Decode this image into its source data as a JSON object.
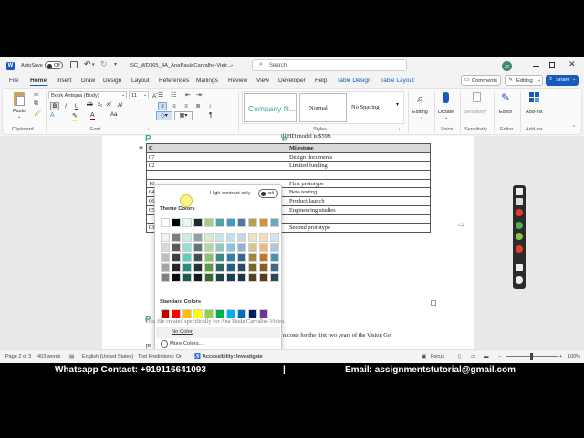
{
  "titlebar": {
    "autosave_label": "AutoSave",
    "autosave_state": "Off",
    "doc_title": "SC_WD365_4A_AnaPaulaCarvalho-Vieir...",
    "search_placeholder": "Search",
    "user_initials": "JG"
  },
  "menu": {
    "items": [
      "File",
      "Home",
      "Insert",
      "Draw",
      "Design",
      "Layout",
      "References",
      "Mailings",
      "Review",
      "View",
      "Developer",
      "Help",
      "Table Design",
      "Table Layout"
    ],
    "comments_label": "Comments",
    "editing_label": "Editing",
    "share_label": "Share"
  },
  "ribbon": {
    "paste_label": "Paste",
    "clipboard_label": "Clipboard",
    "font_name": "Book Antiqua (Body)",
    "font_size": "11",
    "font_label": "Font",
    "styles": [
      "Company N...",
      "Normal",
      "No Spacing"
    ],
    "styles_label": "Styles",
    "editing_label": "Editing",
    "dictate_label": "Dictate",
    "sensitivity_label": "Sensitivity",
    "editor_label": "Editor",
    "addins_label": "Add-ins",
    "voice_label": "Voice",
    "bold": "B",
    "italic": "I",
    "underline": "U",
    "pilcrow": "¶"
  },
  "document": {
    "line1": "ill HD model is $599.",
    "heading_partial": "P",
    "heading_partial2": "P",
    "heading_suffix": "e",
    "para_fragment": "n costs for the first two years of the Vision Go",
    "para_fragment2": "pr",
    "table_header": [
      "C",
      "Milestone"
    ],
    "table_rows": [
      [
        "07",
        "Design documents"
      ],
      [
        "02",
        "Limited funding"
      ],
      [
        "",
        ""
      ],
      [
        "10",
        "First prototype"
      ],
      [
        "04",
        "Beta testing"
      ],
      [
        "06",
        "Product launch"
      ],
      [
        "05",
        "Engineering studies"
      ],
      [
        "",
        ""
      ],
      [
        "03",
        "Second prototype"
      ]
    ],
    "footer_note": "This file created specifically for Ana Paula Carvalho-Vieira"
  },
  "palette": {
    "high_contrast_label": "High-contrast only",
    "high_contrast_state": "Off",
    "theme_label": "Theme Colors",
    "standard_label": "Standard Colors",
    "no_color_label": "No Color",
    "more_colors_label": "More Colors...",
    "theme_top": [
      "#ffffff",
      "#000000",
      "#e6f7f4",
      "#1f2b2b",
      "#9ccf8a",
      "#4ea6a0",
      "#3d9bc5",
      "#4b78a8",
      "#b9a04e",
      "#d88f38",
      "#6fa5c4"
    ],
    "theme_shades": [
      [
        "#f2f2f2",
        "#7f7f7f",
        "#c9efe8",
        "#8fa3a3",
        "#d6ebcd",
        "#c9e4e2",
        "#c3e0ef",
        "#c8d6e7",
        "#ebe2c6",
        "#f6dcbc",
        "#d3e4ee"
      ],
      [
        "#d9d9d9",
        "#595959",
        "#93dfd2",
        "#5f7777",
        "#b1d8a1",
        "#93c9c5",
        "#8ac2e0",
        "#94afd0",
        "#d7c58e",
        "#edb97b",
        "#a8cadd"
      ],
      [
        "#bfbfbf",
        "#3f3f3f",
        "#5dcfbd",
        "#3e5050",
        "#84c46e",
        "#3c8a85",
        "#2f80a6",
        "#3a6290",
        "#a0883c",
        "#c2772a",
        "#4e8fb5"
      ],
      [
        "#a6a6a6",
        "#262626",
        "#2a8c7c",
        "#273232",
        "#5c9a46",
        "#2d6864",
        "#236080",
        "#2c4a6c",
        "#78662d",
        "#915a20",
        "#3b6b88"
      ],
      [
        "#7f7f7f",
        "#0d0d0d",
        "#1c5d53",
        "#141a1a",
        "#3d672f",
        "#1e4542",
        "#174055",
        "#1d3148",
        "#50441e",
        "#603c15",
        "#27475a"
      ]
    ],
    "standard": [
      "#c00000",
      "#ff0000",
      "#ffc000",
      "#ffff00",
      "#92d050",
      "#00b050",
      "#00b0f0",
      "#0070c0",
      "#002060",
      "#7030a0"
    ]
  },
  "statusbar": {
    "page": "Page 2 of 3",
    "words": "403 words",
    "language": "English (United States)",
    "predictions": "Text Predictions: On",
    "accessibility": "Accessibility: Investigate",
    "focus": "Focus",
    "zoom": "100%"
  },
  "footer": {
    "whatsapp": "Whatsapp Contact: +919116641093",
    "divider": "|",
    "email": "Email: assignmentstutorial@gmail.com"
  }
}
